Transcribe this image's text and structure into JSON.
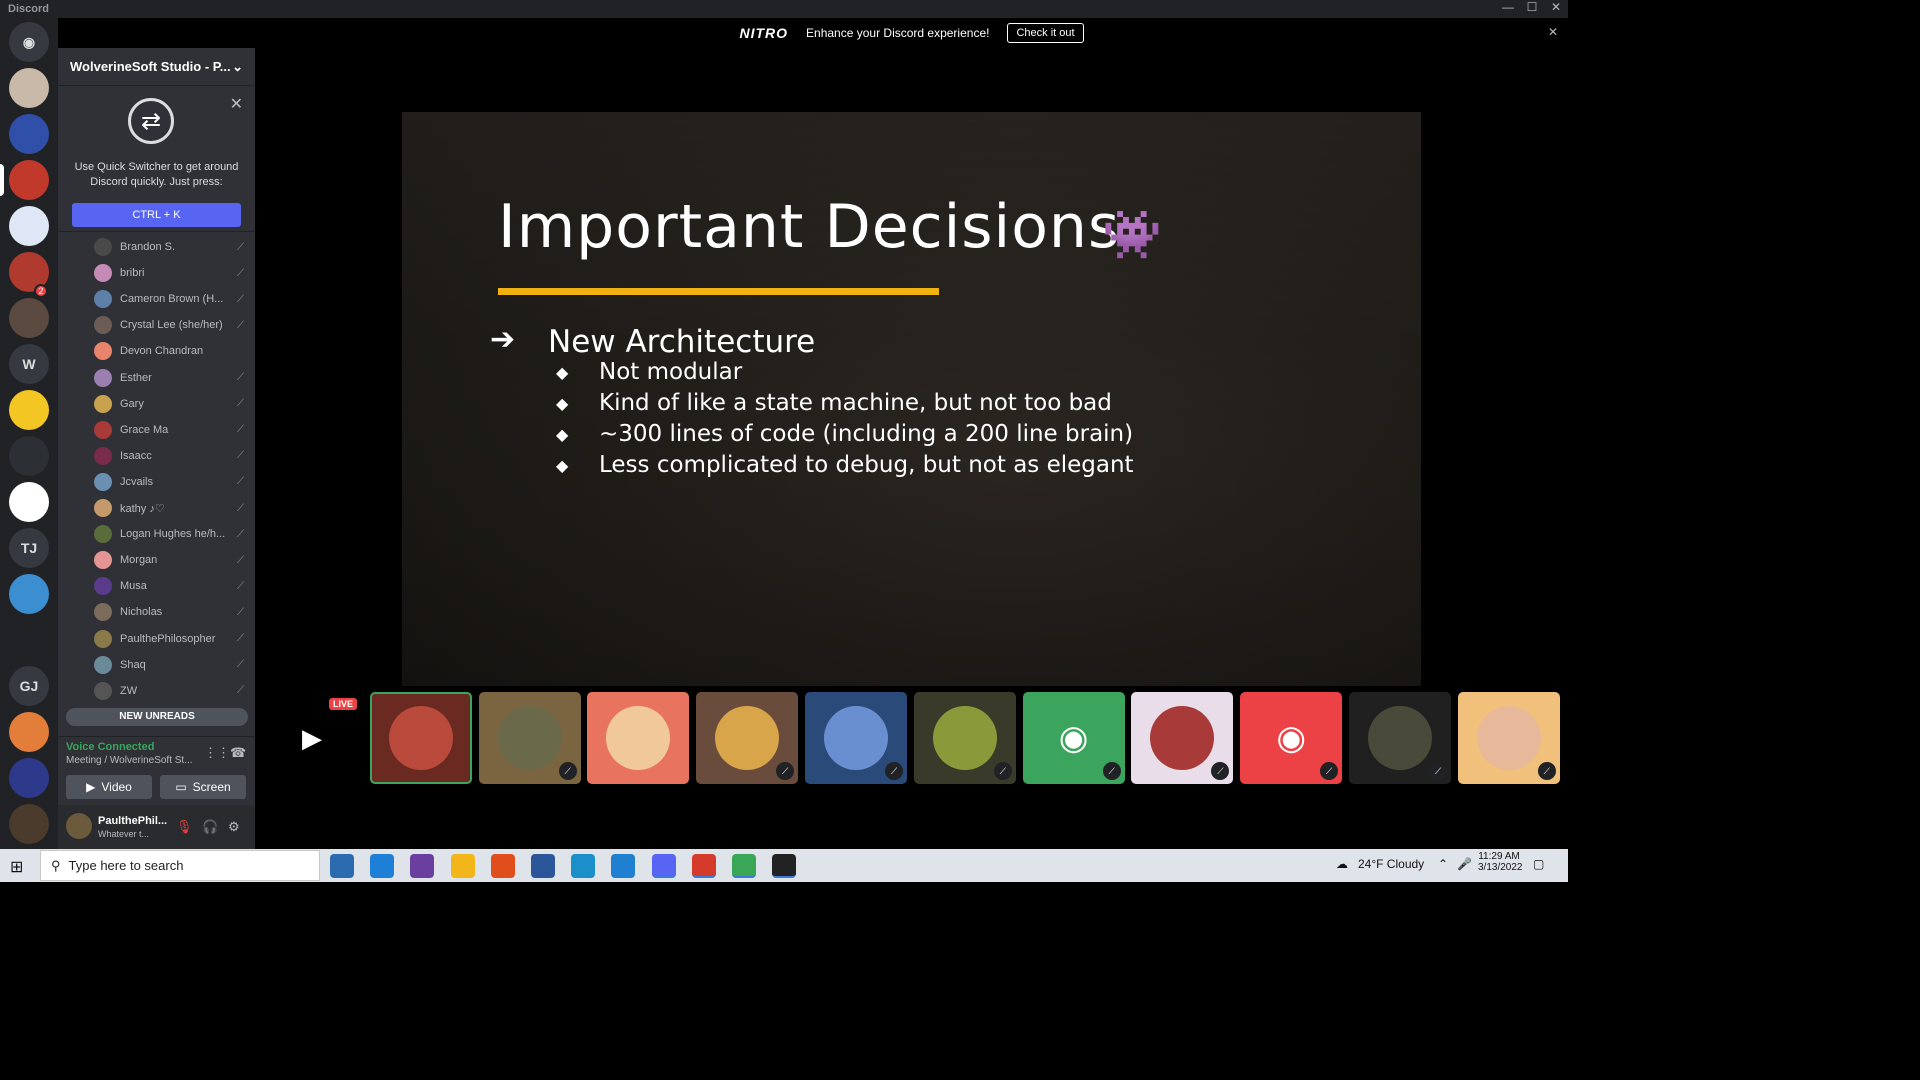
{
  "window": {
    "app_name": "Discord",
    "min": "—",
    "max": "☐",
    "close": "✕"
  },
  "nitro": {
    "logo": "NITRO",
    "message": "Enhance your Discord experience!",
    "cta": "Check it out",
    "close": "✕"
  },
  "guilds": [
    {
      "label": "",
      "icon": "discord-home-icon",
      "color": "#36393f"
    },
    {
      "label": "",
      "icon": "server-avatar",
      "color": "#c9b9a8"
    },
    {
      "label": "",
      "icon": "server-avatar",
      "color": "#2f4fa8"
    },
    {
      "label": "",
      "icon": "server-avatar",
      "color": "#c0392b"
    },
    {
      "label": "",
      "icon": "server-avatar",
      "color": "#dfe6f5"
    },
    {
      "label": "",
      "icon": "server-avatar",
      "color": "#b03a2e"
    },
    {
      "label": "",
      "icon": "server-avatar",
      "color": "#5b4a3f"
    },
    {
      "label": "W",
      "icon": "",
      "color": "#36393f"
    },
    {
      "label": "",
      "icon": "server-avatar",
      "color": "#f3c623"
    },
    {
      "label": "",
      "icon": "server-avatar",
      "color": "#2c2f33"
    },
    {
      "label": "",
      "icon": "server-avatar",
      "color": "#ffffff"
    },
    {
      "label": "TJ",
      "icon": "",
      "color": "#36393f"
    },
    {
      "label": "",
      "icon": "server-avatar",
      "color": "#3b8ed0"
    },
    {
      "label": "",
      "icon": "server-avatar",
      "color": "#202225"
    },
    {
      "label": "GJ",
      "icon": "",
      "color": "#36393f"
    },
    {
      "label": "",
      "icon": "server-avatar",
      "color": "#e27d3a"
    },
    {
      "label": "",
      "icon": "server-avatar",
      "color": "#2d3a8c"
    },
    {
      "label": "",
      "icon": "server-avatar",
      "color": "#4a3b2c"
    }
  ],
  "guild_badges": [
    "2"
  ],
  "server": {
    "name": "WolverineSoft Studio - P..."
  },
  "quick_switcher": {
    "text": "Use Quick Switcher to get around Discord quickly. Just press:",
    "shortcut": "CTRL + K"
  },
  "members": [
    {
      "name": "Brandon S.",
      "color": "#4a4a4a"
    },
    {
      "name": "bribri",
      "color": "#c58ab5"
    },
    {
      "name": "Cameron Brown (H...",
      "color": "#5e7fa8"
    },
    {
      "name": "Crystal Lee (she/her)",
      "color": "#6b5d56"
    },
    {
      "name": "Devon Chandran",
      "color": "#e8846b"
    },
    {
      "name": "Esther",
      "color": "#9a7fb0"
    },
    {
      "name": "Gary",
      "color": "#c8a24f"
    },
    {
      "name": "Grace Ma",
      "color": "#a83a3a"
    },
    {
      "name": "Isaacc",
      "color": "#7a2a4a"
    },
    {
      "name": "Jcvails",
      "color": "#6b8fb0"
    },
    {
      "name": "kathy ♪♡",
      "color": "#c49a6c"
    },
    {
      "name": "Logan Hughes he/h...",
      "color": "#5a6b3c"
    },
    {
      "name": "Morgan",
      "color": "#e59494"
    },
    {
      "name": "Musa",
      "color": "#5a3b8c"
    },
    {
      "name": "Nicholas",
      "color": "#7a6b5a"
    },
    {
      "name": "PaulthePhilosopher",
      "color": "#8a7a4a"
    },
    {
      "name": "Shaq",
      "color": "#6a8a9a"
    },
    {
      "name": "ZW",
      "color": "#555555"
    }
  ],
  "new_unreads": "NEW UNREADS",
  "voice": {
    "status": "Voice Connected",
    "channel": "Meeting / WolverineSoft St...",
    "video": "Video",
    "screen": "Screen"
  },
  "user": {
    "name": "PaulthePhil...",
    "status": "Whatever t..."
  },
  "slide": {
    "title": "Important Decisions",
    "heading": "New Architecture",
    "arrow": "➔",
    "bullet": "◆",
    "bullets": [
      "Not modular",
      "Kind of like a state machine, but not too bad",
      "~300 lines of code (including a 200 line brain)",
      "Less complicated to debug, but not as elegant"
    ]
  },
  "tiles": [
    {
      "type": "live",
      "label": "LIVE",
      "color": "#3a3a3a"
    },
    {
      "type": "avatar",
      "color": "#b94a3c",
      "bg": "#6a2a22",
      "muted": false,
      "selected": true
    },
    {
      "type": "avatar",
      "color": "#6a6a4a",
      "bg": "#7a6540",
      "muted": true
    },
    {
      "type": "avatar",
      "color": "#f0c89a",
      "bg": "#e8735e",
      "muted": false
    },
    {
      "type": "avatar",
      "color": "#d9a54a",
      "bg": "#6a4c3c",
      "muted": true
    },
    {
      "type": "avatar",
      "color": "#6a8fd0",
      "bg": "#2a4a7a",
      "muted": true
    },
    {
      "type": "avatar",
      "color": "#8a9a3a",
      "bg": "#3a3a2a",
      "muted": true
    },
    {
      "type": "discord",
      "color": "#3ba55d",
      "bg": "#3ba55d",
      "muted": true
    },
    {
      "type": "avatar",
      "color": "#a83a3a",
      "bg": "#e8dde8",
      "muted": true
    },
    {
      "type": "discord",
      "color": "#ed4245",
      "bg": "#ed4245",
      "muted": true
    },
    {
      "type": "avatar",
      "color": "#4a4a3a",
      "bg": "#202020",
      "muted": true
    },
    {
      "type": "avatar",
      "color": "#e8b89a",
      "bg": "#f1c07a",
      "muted": true
    }
  ],
  "taskbar": {
    "search_placeholder": "Type here to search",
    "weather": "24°F  Cloudy",
    "time": "11:29 AM",
    "date": "3/13/2022"
  },
  "taskbar_apps": [
    {
      "name": "store",
      "color": "#2b6cb0"
    },
    {
      "name": "mail",
      "color": "#1e7fd6"
    },
    {
      "name": "github",
      "color": "#6b3fa0"
    },
    {
      "name": "explorer",
      "color": "#f2b51a"
    },
    {
      "name": "office",
      "color": "#e04e1b"
    },
    {
      "name": "word",
      "color": "#2b579a"
    },
    {
      "name": "edge",
      "color": "#1a8fc9"
    },
    {
      "name": "vscode",
      "color": "#1f7fd0"
    },
    {
      "name": "discord",
      "color": "#5865f2"
    },
    {
      "name": "app",
      "color": "#d43b2a"
    },
    {
      "name": "chrome",
      "color": "#3aa757"
    },
    {
      "name": "unity",
      "color": "#222222"
    }
  ]
}
